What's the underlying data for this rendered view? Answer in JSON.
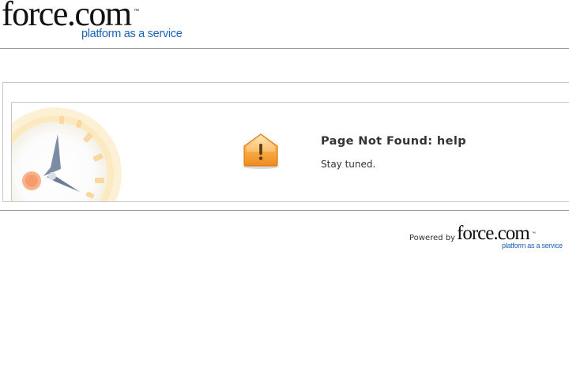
{
  "header": {
    "logo": {
      "brand": "force.com",
      "trademark": "™",
      "tagline": "platform as a service"
    }
  },
  "error": {
    "title": "Page Not Found: help",
    "message": "Stay tuned.",
    "icon": "warning-icon",
    "watermark": "clock-icon"
  },
  "footer": {
    "powered_by": "Powered by",
    "logo": {
      "brand": "force.com",
      "trademark": "™",
      "tagline": "platform as a service"
    }
  },
  "colors": {
    "tagline_blue": "#1d63b7",
    "warning_orange": "#f39a2b",
    "rule_gray": "#9a9a9a",
    "text": "#333333"
  }
}
